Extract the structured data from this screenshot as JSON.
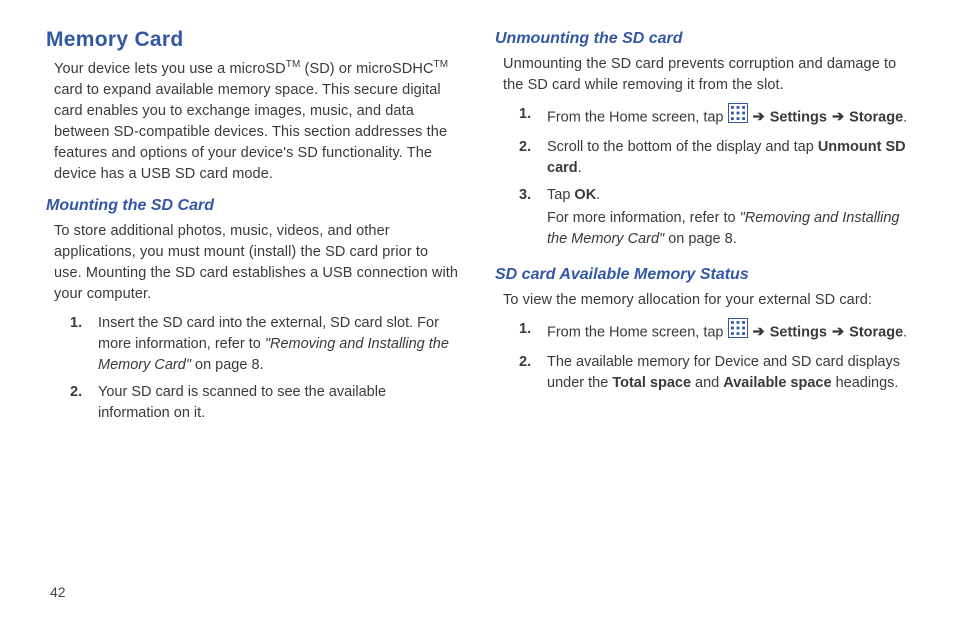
{
  "page_number": "42",
  "left": {
    "heading": "Memory Card",
    "intro_parts": {
      "p1": "Your device lets you use a microSD",
      "tm1": "TM",
      "p2": " (SD) or microSDHC",
      "tm2": "TM",
      "p3": " card to expand available memory space. This secure digital card enables you to exchange images, music, and data between SD-compatible devices. This section addresses the features and options of your device's SD functionality. The device has a USB SD card mode."
    },
    "sub1": {
      "heading": "Mounting the SD Card",
      "body": "To store additional photos, music, videos, and other applications, you must mount (install) the SD card prior to use. Mounting the SD card establishes a USB connection with your computer.",
      "steps": {
        "s1a": "Insert the SD card into the external, SD card slot. For more information, refer to ",
        "s1_ref": "\"Removing and Installing the Memory Card\" ",
        "s1b": " on page 8.",
        "s2": "Your SD card is scanned to see the available information on it."
      }
    }
  },
  "right": {
    "sub2": {
      "heading": "Unmounting the SD card",
      "body": "Unmounting the SD card prevents corruption and damage to the SD card while removing it from the slot.",
      "steps": {
        "s1a": "From the Home screen, tap ",
        "s1b": " ",
        "s1_settings": "Settings",
        "s1_storage": "Storage",
        "s1_period": ".",
        "s2a": "Scroll to the bottom of the display and tap ",
        "s2_bold": "Unmount SD card",
        "s2b": ".",
        "s3a": "Tap ",
        "s3_bold": "OK",
        "s3b": ".",
        "s3c": "For more information, refer to ",
        "s3_ref": "\"Removing and Installing the Memory Card\" ",
        "s3d": " on page 8."
      }
    },
    "sub3": {
      "heading": "SD card Available Memory Status",
      "body": "To view the memory allocation for your external SD card:",
      "steps": {
        "s1a": "From the Home screen, tap ",
        "s1b": " ",
        "s1_settings": "Settings",
        "s1_storage": "Storage",
        "s1_period": ".",
        "s2a": "The available memory for Device and SD card displays under the ",
        "s2_bold1": "Total space",
        "s2_mid": " and ",
        "s2_bold2": "Available space",
        "s2b": " headings."
      }
    }
  },
  "arrow_glyph": "➔"
}
